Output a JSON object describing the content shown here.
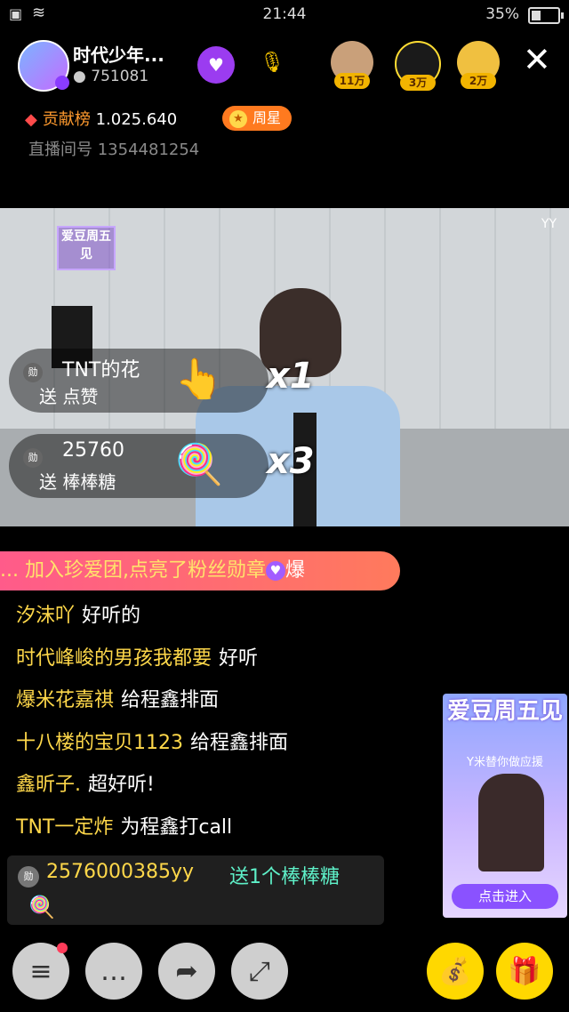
{
  "status_bar": {
    "time": "21:44",
    "battery": "35%",
    "battery_level": 0.35
  },
  "host": {
    "name": "时代少年...",
    "fans": "751081"
  },
  "rankings": [
    {
      "label": "11万",
      "color": "#c9a07a"
    },
    {
      "label": "3万",
      "color": "#ffdd33"
    },
    {
      "label": "2万",
      "color": "#f0c040"
    }
  ],
  "contribution": {
    "label": "贡献榜",
    "value": "1.025.640"
  },
  "week_star": "周星",
  "room": {
    "label": "直播间号",
    "id": "1354481254"
  },
  "video": {
    "logo": "爱豆周五见",
    "watermark": "YY"
  },
  "gift_banners": [
    {
      "medal": "勋",
      "name": "TNT的花",
      "action": "送 点赞",
      "icon": "👆",
      "count": "x1"
    },
    {
      "medal": "勋",
      "name": "25760",
      "action": "送 棒棒糖",
      "icon": "🍭",
      "count": "x3"
    }
  ],
  "fan_join": {
    "text": "... 加入珍爱团,点亮了粉丝勋章",
    "suffix": "爆"
  },
  "chat": [
    {
      "user": "汐沫吖",
      "msg": "好听的"
    },
    {
      "user": "时代峰峻的男孩我都要",
      "msg": "好听"
    },
    {
      "user": "爆米花嘉祺",
      "msg": "给程鑫排面"
    },
    {
      "user": "十八楼的宝贝1123",
      "msg": "给程鑫排面"
    },
    {
      "user": "鑫昕子.",
      "msg": "超好听!"
    },
    {
      "user": "TNT一定炸",
      "msg": "为程鑫打call"
    }
  ],
  "gift_msg": {
    "medal": "勋",
    "user": "2576000385yy",
    "msg": "送1个棒棒糖",
    "icon": "🍭"
  },
  "promo": {
    "title": "爱豆周五见",
    "subtitle": "Y米替你做应援",
    "button": "点击进入"
  },
  "toolbar": {
    "menu": "≡",
    "chat": "…",
    "share": "➦",
    "fullscreen": "⤢",
    "bag": "💰",
    "gift": "🎁"
  }
}
